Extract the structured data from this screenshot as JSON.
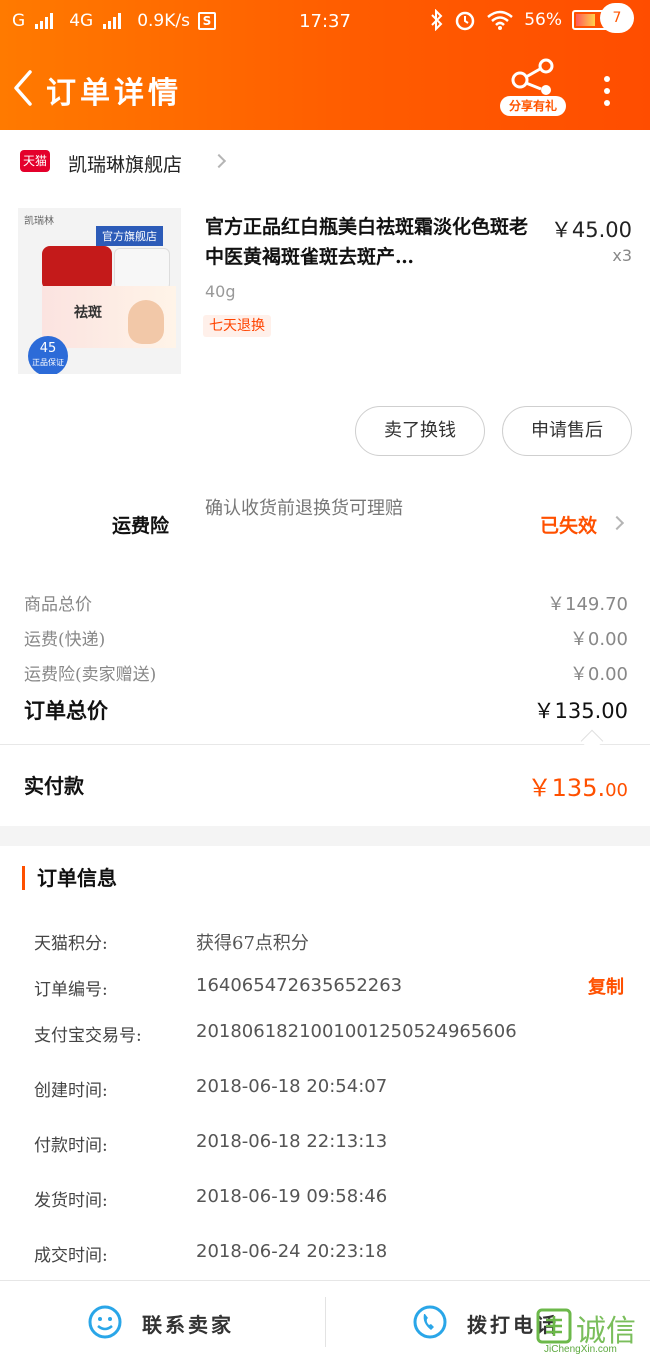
{
  "status_bar": {
    "carrier": "G",
    "network": "4G",
    "speed": "0.9K/s",
    "s_icon": "S",
    "time": "17:37",
    "battery": "56%",
    "battery_level": 0.56,
    "icons": [
      "bluetooth-icon",
      "alarm-icon",
      "wifi-icon",
      "battery-icon",
      "charging-icon"
    ]
  },
  "header": {
    "title": "订单详情",
    "share_label": "分享有礼",
    "message_count": "7",
    "bg_color": "#ff6600"
  },
  "shop": {
    "badge": "天猫",
    "name": "凯瑞琳旗舰店"
  },
  "product": {
    "image_brand": "凯瑞林",
    "image_official": "官方旗舰店",
    "image_box_text": "祛斑",
    "image_price": "45",
    "image_price_sub": "正品保证",
    "title": "官方正品红白瓶美白祛斑霜淡化色斑老中医黄褐斑雀斑去斑产…",
    "price": "￥45.00",
    "quantity": "x3",
    "spec": "40g",
    "tag": "七天退换"
  },
  "actions": {
    "sell": "卖了换钱",
    "after_sale": "申请售后"
  },
  "insurance": {
    "label": "运费险",
    "description": "确认收货前退换货可理赔",
    "status": "已失效"
  },
  "summary": {
    "rows": [
      {
        "label": "商品总价",
        "value": "￥149.70"
      },
      {
        "label": "运费(快递)",
        "value": "￥0.00"
      },
      {
        "label": "运费险(卖家赠送)",
        "value": "￥0.00"
      }
    ],
    "total_label": "订单总价",
    "total_value": "￥135.00",
    "paid_label": "实付款",
    "paid_main": "￥135.",
    "paid_cents": "00"
  },
  "order_info": {
    "title": "订单信息",
    "rows": [
      {
        "key": "天猫积分:",
        "value": "获得67点积分"
      },
      {
        "key": "订单编号:",
        "value": "164065472635652263"
      },
      {
        "key": "支付宝交易号:",
        "value": "2018061821001001250524965606"
      },
      {
        "key": "创建时间:",
        "value": "2018-06-18 20:54:07"
      },
      {
        "key": "付款时间:",
        "value": "2018-06-18 22:13:13"
      },
      {
        "key": "发货时间:",
        "value": "2018-06-19 09:58:46"
      },
      {
        "key": "成交时间:",
        "value": "2018-06-24 20:23:18"
      }
    ],
    "copy_label": "复制"
  },
  "bottom_bar": {
    "contact_seller": "联系卖家",
    "call_phone": "拨打电话"
  },
  "watermark": {
    "text": "诚信",
    "site": "JiChengXin.com"
  },
  "colors": {
    "accent": "#ff5000",
    "icon_blue": "#2aa6e8",
    "tmall_red": "#e4002b"
  }
}
